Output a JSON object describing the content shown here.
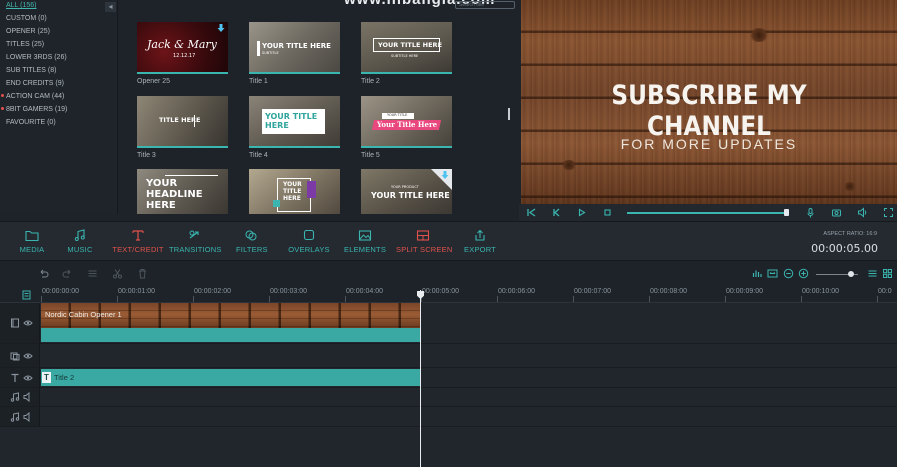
{
  "sidebar": {
    "collapse_glyph": "◂",
    "categories": [
      {
        "label": "ALL (156)",
        "active": true,
        "new": false
      },
      {
        "label": "CUSTOM (0)",
        "active": false,
        "new": false
      },
      {
        "label": "OPENER (25)",
        "active": false,
        "new": false
      },
      {
        "label": "TITLES (25)",
        "active": false,
        "new": false
      },
      {
        "label": "LOWER 3RDS (26)",
        "active": false,
        "new": false
      },
      {
        "label": "SUB TITLES (8)",
        "active": false,
        "new": false
      },
      {
        "label": "END CREDITS (9)",
        "active": false,
        "new": false
      },
      {
        "label": "ACTION CAM (44)",
        "active": false,
        "new": true
      },
      {
        "label": "8BIT GAMERS (19)",
        "active": false,
        "new": true
      },
      {
        "label": "FAVOURITE (0)",
        "active": false,
        "new": false
      }
    ]
  },
  "top_overlay": {
    "url_fragment": "www.inbangla.com",
    "search_placeholder": "Search title"
  },
  "grid": {
    "tiles": [
      {
        "label": "Opener 25",
        "lines": [
          "Jack & Mary",
          "12.12.17"
        ],
        "download": true
      },
      {
        "label": "Title 1",
        "lines": [
          "YOUR TITLE HERE",
          "SUBTITLE"
        ],
        "download": false
      },
      {
        "label": "Title 2",
        "lines": [
          "YOUR TITLE HERE",
          "SUBTITLE HERE"
        ],
        "download": false
      },
      {
        "label": "Title 3",
        "lines": [
          "TITLE HERE"
        ],
        "download": false
      },
      {
        "label": "Title 4",
        "lines": [
          "YOUR TITLE",
          "HERE"
        ],
        "download": false
      },
      {
        "label": "Title 5",
        "lines": [
          "YOUR TITLE",
          "Your Title Here"
        ],
        "download": false
      },
      {
        "label": "",
        "lines": [
          "YOUR",
          "HEADLINE",
          "HERE"
        ],
        "download": false
      },
      {
        "label": "",
        "lines": [
          "YOUR",
          "TITLE",
          "HERE"
        ],
        "download": false
      },
      {
        "label": "",
        "lines": [
          "YOUR PRODUCT",
          "YOUR TITLE HERE"
        ],
        "download": true
      }
    ]
  },
  "preview": {
    "headline": "SUBSCRIBE MY CHANNEL",
    "subline": "FOR MORE UPDATES",
    "progress": 0.99
  },
  "toolbar": {
    "items": [
      {
        "label": "MEDIA",
        "icon": "folder-icon",
        "accent": "#3ab5b0"
      },
      {
        "label": "MUSIC",
        "icon": "music-icon",
        "accent": "#3ab5b0"
      },
      {
        "label": "TEXT/CREDIT",
        "icon": "text-icon",
        "accent": "#e2514a"
      },
      {
        "label": "TRANSITIONS",
        "icon": "transitions-icon",
        "accent": "#3ab5b0"
      },
      {
        "label": "FILTERS",
        "icon": "filters-icon",
        "accent": "#3ab5b0"
      },
      {
        "label": "OVERLAYS",
        "icon": "overlays-icon",
        "accent": "#3ab5b0"
      },
      {
        "label": "ELEMENTS",
        "icon": "elements-icon",
        "accent": "#3ab5b0"
      },
      {
        "label": "SPLIT SCREEN",
        "icon": "split-screen-icon",
        "accent": "#e2514a"
      },
      {
        "label": "EXPORT",
        "icon": "export-icon",
        "accent": "#3ab5b0"
      }
    ],
    "aspect_ratio": "ASPECT RATIO: 16:9",
    "timecode": "00:00:05.00"
  },
  "ruler": {
    "labels": [
      "00:00:00:00",
      "00:00:01:00",
      "00:00:02:00",
      "00:00:03:00",
      "00:00:04:00",
      "00:00:05:00",
      "00:00:06:00",
      "00:00:07:00",
      "00:00:08:00",
      "00:00:09:00",
      "00:00:10:00",
      "00:0"
    ]
  },
  "tracks": {
    "video_clip": "Nordic Cabin Opener 1",
    "title_clip": "Title 2",
    "title_glyph": "T"
  },
  "colors": {
    "accent": "#3ab5b0",
    "accent_red": "#e2514a",
    "background": "#1e2329"
  }
}
